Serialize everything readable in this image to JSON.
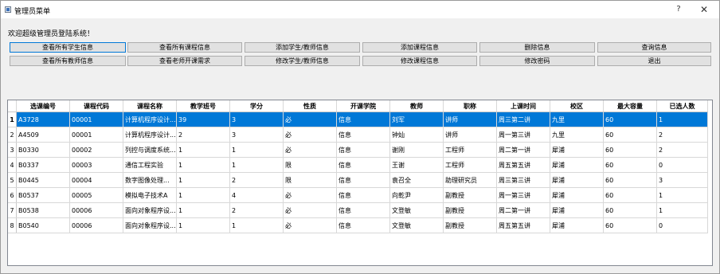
{
  "window": {
    "title": "管理员菜单",
    "help": "?",
    "close": "✕"
  },
  "welcome": "欢迎超级管理员登陆系统！",
  "buttons": {
    "row1": [
      "查看所有学生信息",
      "查看所有课程信息",
      "添加学生/教师信息",
      "添加课程信息",
      "删除信息",
      "查询信息"
    ],
    "row2": [
      "查看所有教师信息",
      "查看老师开课需求",
      "修改学生/教师信息",
      "修改课程信息",
      "修改密码",
      "退出"
    ]
  },
  "table": {
    "headers": [
      "选课编号",
      "课程代码",
      "课程名称",
      "教学班号",
      "学分",
      "性质",
      "开课学院",
      "教师",
      "职称",
      "上课时间",
      "校区",
      "最大容量",
      "已选人数"
    ],
    "selected_row": 0,
    "rows": [
      [
        "1",
        "A3728",
        "00001",
        "计算机程序设计...",
        "39",
        "3",
        "必",
        "信息",
        "刘军",
        "讲师",
        "周三第二讲",
        "九里",
        "60",
        "1"
      ],
      [
        "2",
        "A4509",
        "00001",
        "计算机程序设计...",
        "2",
        "3",
        "必",
        "信息",
        "钟灿",
        "讲师",
        "周一第三讲",
        "九里",
        "60",
        "2"
      ],
      [
        "3",
        "B0330",
        "00002",
        "列控与调度系统...",
        "1",
        "1",
        "必",
        "信息",
        "谢刚",
        "工程师",
        "周二第一讲",
        "犀浦",
        "60",
        "2"
      ],
      [
        "4",
        "B0337",
        "00003",
        "通信工程实验",
        "1",
        "1",
        "限",
        "信息",
        "王谢",
        "工程师",
        "周五第五讲",
        "犀浦",
        "60",
        "0"
      ],
      [
        "5",
        "B0445",
        "00004",
        "数字图像处理...",
        "1",
        "2",
        "限",
        "信息",
        "袁召全",
        "助理研究员",
        "周三第三讲",
        "犀浦",
        "60",
        "3"
      ],
      [
        "6",
        "B0537",
        "00005",
        "模拟电子技术A",
        "1",
        "4",
        "必",
        "信息",
        "向乾尹",
        "副教授",
        "周一第三讲",
        "犀浦",
        "60",
        "1"
      ],
      [
        "7",
        "B0538",
        "00006",
        "面向对象程序设...",
        "1",
        "2",
        "必",
        "信息",
        "文登敏",
        "副教授",
        "周二第一讲",
        "犀浦",
        "60",
        "1"
      ],
      [
        "8",
        "B0540",
        "00006",
        "面向对象程序设...",
        "1",
        "1",
        "必",
        "信息",
        "文登敏",
        "副教授",
        "周五第五讲",
        "犀浦",
        "60",
        "0"
      ]
    ]
  }
}
